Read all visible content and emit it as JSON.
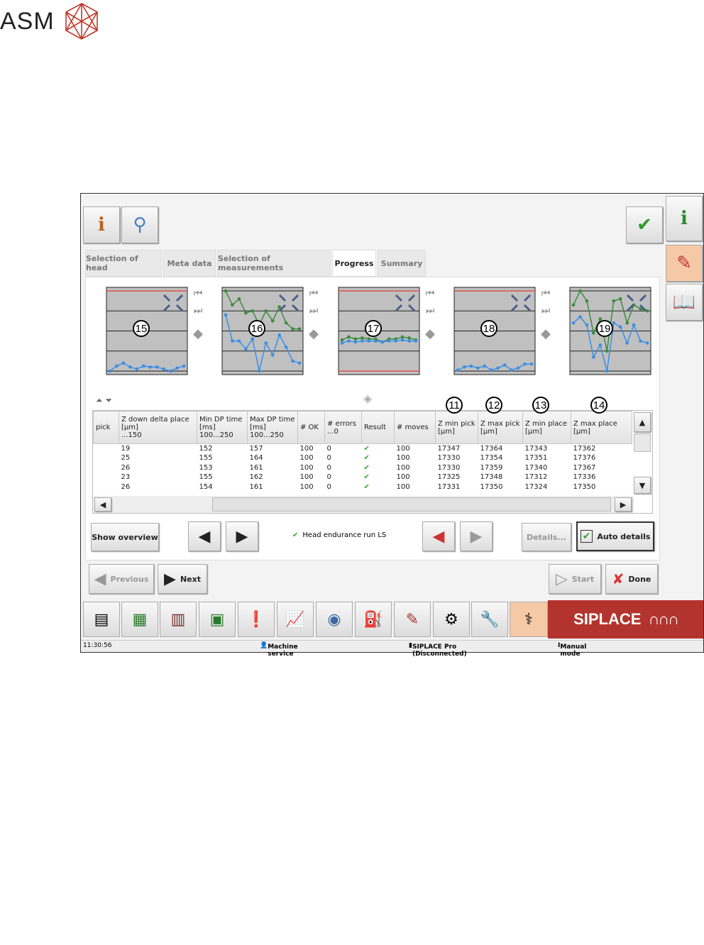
{
  "logo": {
    "text": "ASM"
  },
  "tabs": [
    {
      "label": "Selection of head"
    },
    {
      "label": "Meta data"
    },
    {
      "label": "Selection of measurements"
    },
    {
      "label": "Progress",
      "active": true
    },
    {
      "label": "Summary"
    }
  ],
  "charts": [
    {
      "callout": "15",
      "series": [
        {
          "color": "#3a8ee6",
          "values": [
            0,
            0.25,
            0.4,
            0.2,
            0.1,
            0.25,
            0.2,
            0.2,
            0.1,
            0,
            0.15,
            0.25
          ]
        }
      ],
      "limits": [
        4
      ]
    },
    {
      "callout": "16",
      "series": [
        {
          "color": "#3d8a3d",
          "values": [
            4,
            3.3,
            3.6,
            2.9,
            3,
            2.3,
            3,
            2.5,
            3.2,
            2.4,
            2.1,
            2.1
          ]
        },
        {
          "color": "#3a8ee6",
          "values": [
            2.8,
            1.5,
            1.5,
            1.1,
            1.6,
            0,
            1.4,
            0.8,
            1.8,
            1.2,
            0.5,
            0.4
          ]
        }
      ],
      "limits": []
    },
    {
      "callout": "17",
      "series": [
        {
          "color": "#3d8a3d",
          "values": [
            1.55,
            1.7,
            1.6,
            1.65,
            1.6,
            1.6,
            1.45,
            1.6,
            1.6,
            1.7,
            1.65,
            1.55
          ]
        },
        {
          "color": "#3a8ee6",
          "values": [
            1.4,
            1.5,
            1.45,
            1.5,
            1.5,
            1.5,
            1.45,
            1.5,
            1.5,
            1.55,
            1.5,
            1.5
          ]
        }
      ],
      "limits": [
        4,
        0
      ]
    },
    {
      "callout": "18",
      "series": [
        {
          "color": "#3a8ee6",
          "values": [
            0.05,
            0.2,
            0.25,
            0.15,
            0.25,
            0.05,
            0.15,
            0.3,
            0.05,
            0.15,
            0.35,
            0.35
          ]
        }
      ],
      "limits": [
        4
      ]
    },
    {
      "callout": "19",
      "series": [
        {
          "color": "#3d8a3d",
          "values": [
            3.3,
            4,
            3.5,
            1.9,
            2.6,
            1,
            3.5,
            3.6,
            2.4,
            3.3,
            3.1,
            3
          ]
        },
        {
          "color": "#3a8ee6",
          "values": [
            2.4,
            2.7,
            2.3,
            0.7,
            1.3,
            0,
            2.4,
            2.2,
            1.4,
            2.3,
            1.5,
            1.4
          ]
        }
      ],
      "limits": []
    }
  ],
  "table": {
    "headers": [
      [
        "pick"
      ],
      [
        "Z down delta place",
        "[µm]",
        "...150"
      ],
      [
        "Min DP time",
        "[ms]",
        "100...250"
      ],
      [
        "Max DP time",
        "[ms]",
        "100...250"
      ],
      [
        "# OK"
      ],
      [
        "# errors",
        "...0"
      ],
      [
        "Result"
      ],
      [
        "# moves"
      ],
      [
        "Z min pick",
        "[µm]"
      ],
      [
        "Z max pick",
        "[µm]"
      ],
      [
        "Z min place",
        "[µm]"
      ],
      [
        "Z max place",
        "[µm]"
      ]
    ],
    "callouts": [
      "11",
      "12",
      "13",
      "14"
    ],
    "rows": [
      [
        "",
        "19",
        "152",
        "157",
        "100",
        "0",
        "✔",
        "100",
        "17347",
        "17364",
        "17343",
        "17362"
      ],
      [
        "",
        "25",
        "155",
        "164",
        "100",
        "0",
        "✔",
        "100",
        "17330",
        "17354",
        "17351",
        "17376"
      ],
      [
        "",
        "26",
        "153",
        "161",
        "100",
        "0",
        "✔",
        "100",
        "17330",
        "17359",
        "17340",
        "17367"
      ],
      [
        "",
        "23",
        "155",
        "162",
        "100",
        "0",
        "✔",
        "100",
        "17325",
        "17348",
        "17312",
        "17336"
      ],
      [
        "",
        "26",
        "154",
        "161",
        "100",
        "0",
        "✔",
        "100",
        "17331",
        "17350",
        "17324",
        "17350"
      ]
    ]
  },
  "controls": {
    "show_overview": "Show overview",
    "status_text": "Head endurance run LS",
    "details": "Details...",
    "auto_details": "Auto details",
    "previous": "Previous",
    "next": "Next",
    "start": "Start",
    "done": "Done"
  },
  "brand": "SIPLACE",
  "status": {
    "time": "11:30:56",
    "service": "Machine service",
    "pro": "SIPLACE Pro (Disconnected)",
    "mode": "Manual mode"
  }
}
